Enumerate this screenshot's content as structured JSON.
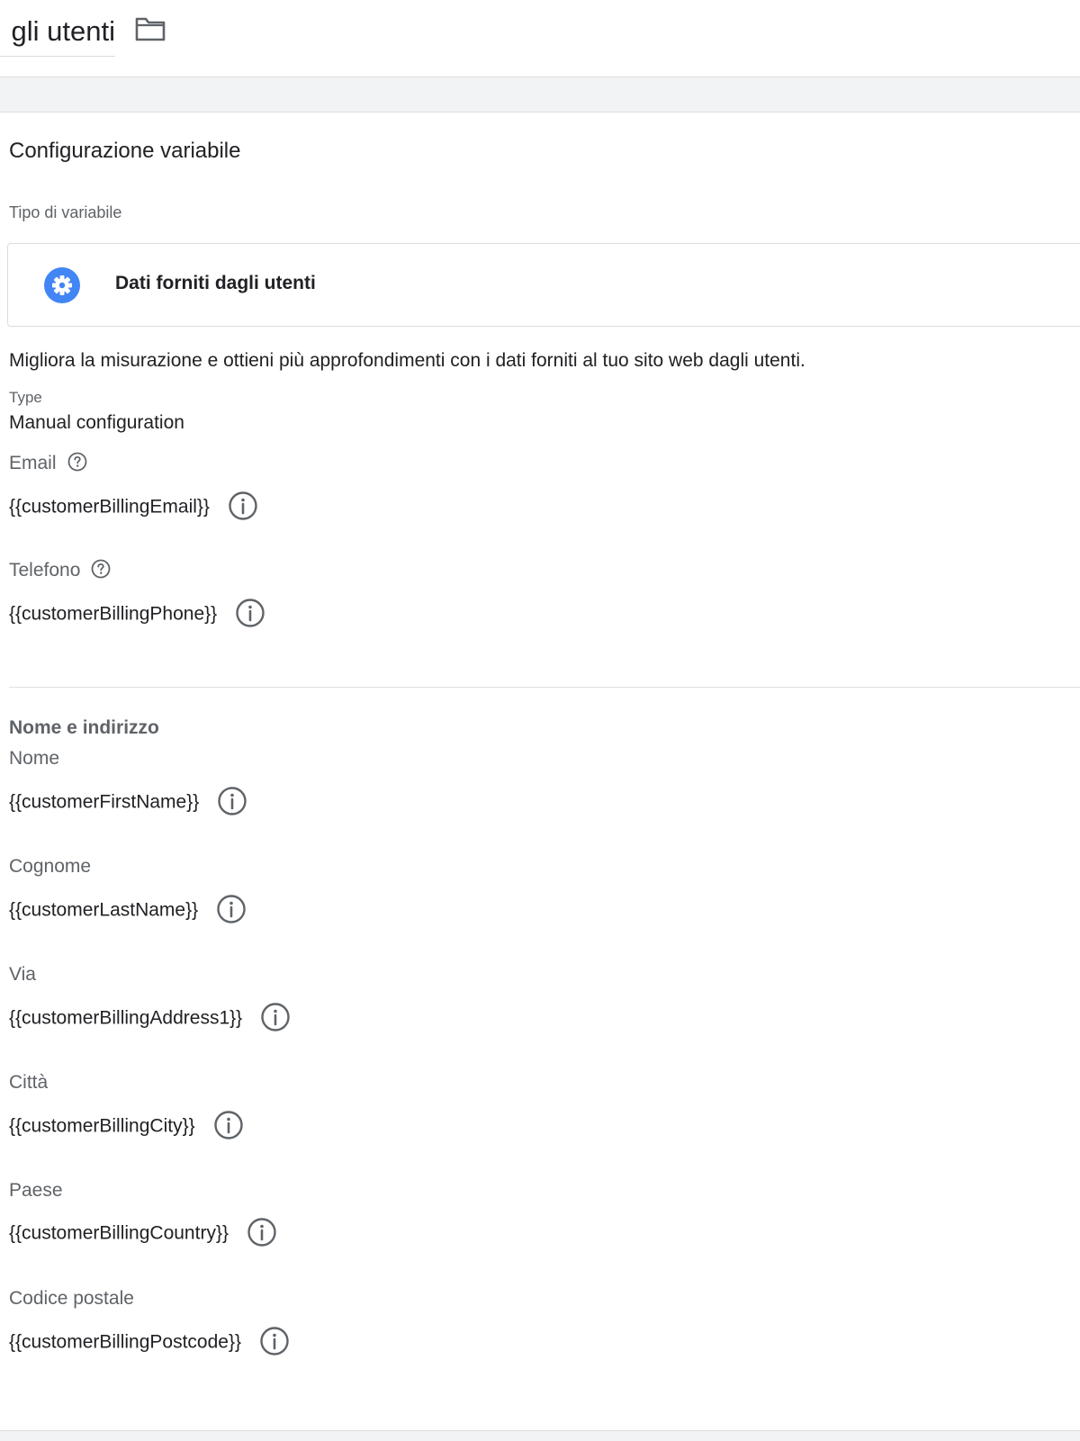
{
  "header": {
    "title": "gli utenti",
    "folder_icon": "folder-icon"
  },
  "config": {
    "section_title": "Configurazione variabile",
    "type_label": "Tipo di variabile",
    "variable_type": {
      "icon": "gear-icon",
      "icon_color": "#4285f4",
      "name": "Dati forniti dagli utenti"
    },
    "description": "Migliora la misurazione e ottieni più approfondimenti con i dati forniti al tuo sito web dagli utenti.",
    "type_field_label": "Type",
    "type_field_value": "Manual configuration",
    "email": {
      "label": "Email",
      "value": "{{customerBillingEmail}}"
    },
    "phone": {
      "label": "Telefono",
      "value": "{{customerBillingPhone}}"
    },
    "address_section_title": "Nome e indirizzo",
    "first_name": {
      "label": "Nome",
      "value": "{{customerFirstName}}"
    },
    "last_name": {
      "label": "Cognome",
      "value": "{{customerLastName}}"
    },
    "street": {
      "label": "Via",
      "value": "{{customerBillingAddress1}}"
    },
    "city": {
      "label": "Città",
      "value": "{{customerBillingCity}}"
    },
    "country": {
      "label": "Paese",
      "value": "{{customerBillingCountry}}"
    },
    "postal_code": {
      "label": "Codice postale",
      "value": "{{customerBillingPostcode}}"
    }
  }
}
